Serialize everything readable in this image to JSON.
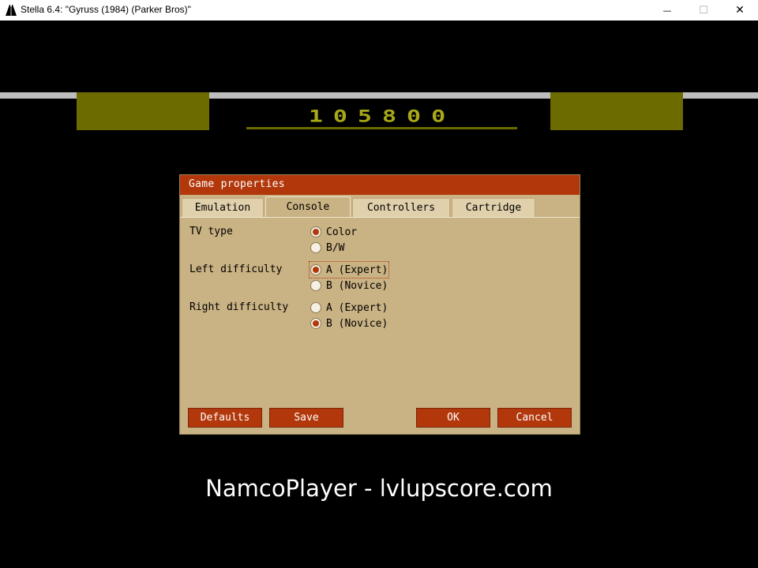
{
  "window": {
    "title": "Stella 6.4: \"Gyruss (1984) (Parker Bros)\"",
    "minimize": "—",
    "maximize": "☐",
    "close": "✕"
  },
  "game": {
    "score": "105800",
    "watermark": "NamcoPlayer - lvlupscore.com"
  },
  "dialog": {
    "title": "Game properties",
    "tabs": [
      {
        "label": "Emulation",
        "active": false
      },
      {
        "label": "Console",
        "active": true
      },
      {
        "label": "Controllers",
        "active": false
      },
      {
        "label": "Cartridge",
        "active": false
      }
    ],
    "fields": {
      "tv_type": {
        "label": "TV type",
        "options": [
          {
            "label": "Color",
            "selected": true
          },
          {
            "label": "B/W",
            "selected": false
          }
        ]
      },
      "left_difficulty": {
        "label": "Left difficulty",
        "options": [
          {
            "label": "A (Expert)",
            "selected": true
          },
          {
            "label": "B (Novice)",
            "selected": false
          }
        ]
      },
      "right_difficulty": {
        "label": "Right difficulty",
        "options": [
          {
            "label": "A (Expert)",
            "selected": false
          },
          {
            "label": "B (Novice)",
            "selected": true
          }
        ]
      }
    },
    "buttons": {
      "defaults": "Defaults",
      "save": "Save",
      "ok": "OK",
      "cancel": "Cancel"
    }
  },
  "colors": {
    "accent": "#b2380c",
    "dialog_bg": "#c9b283",
    "hud_olive": "#6b6b00",
    "score_yellow": "#a8a818"
  }
}
